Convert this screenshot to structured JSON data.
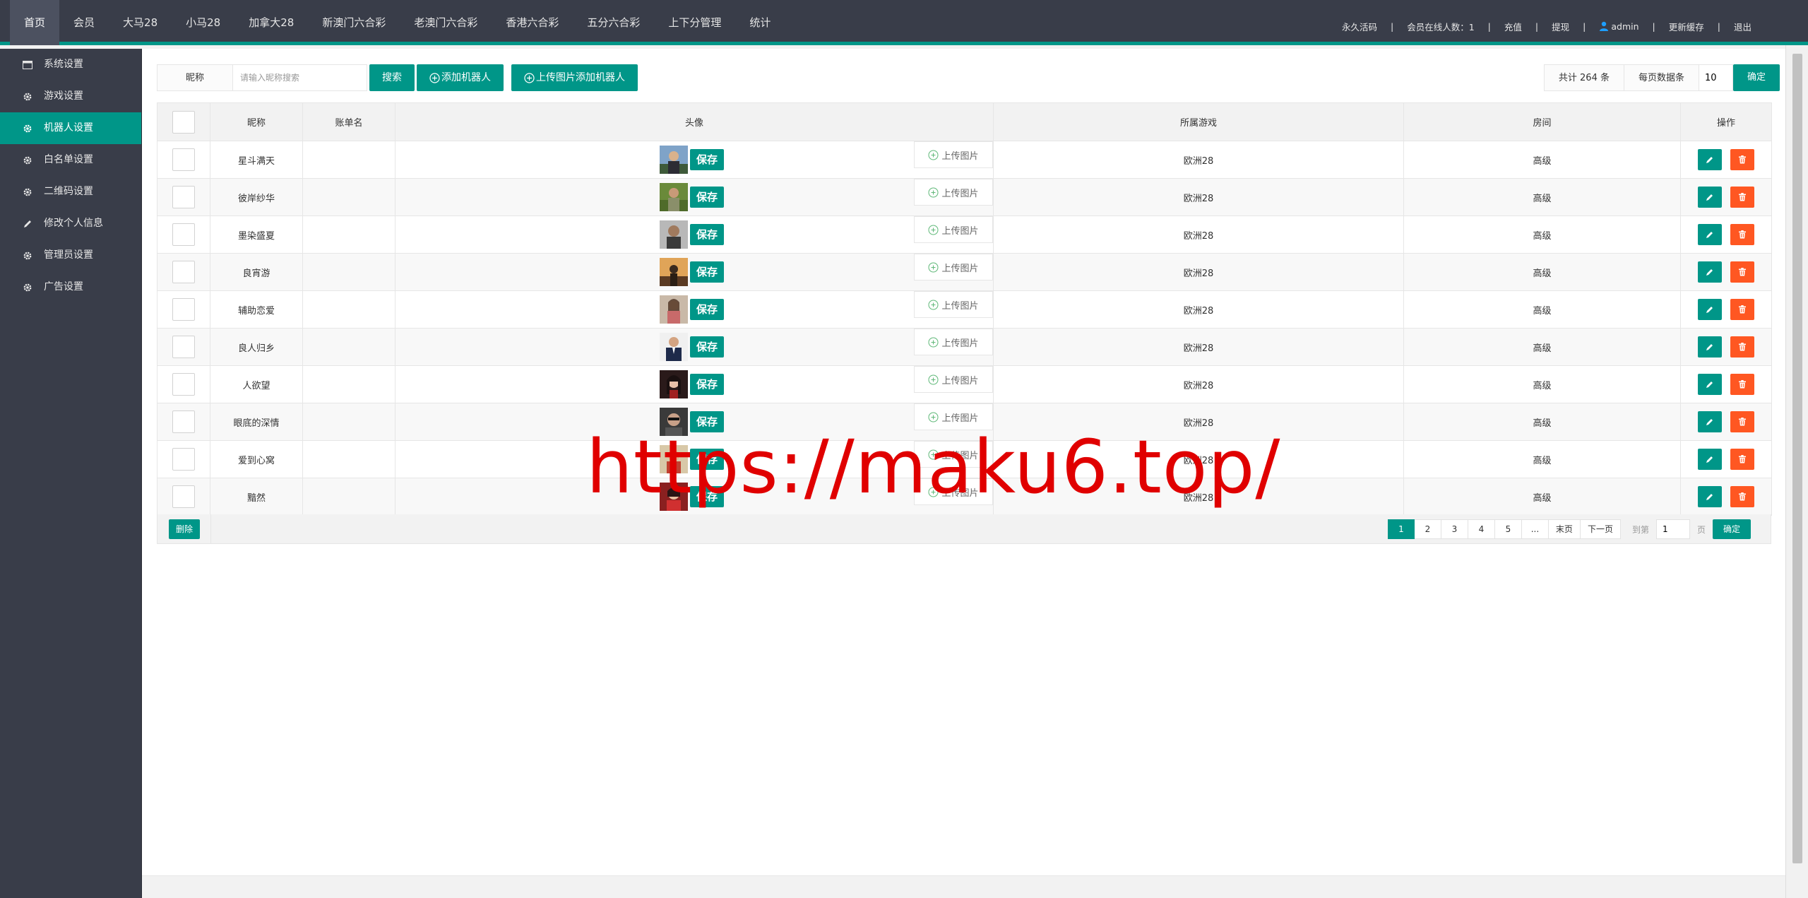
{
  "topnav": {
    "items": [
      {
        "label": "首页",
        "active": true
      },
      {
        "label": "会员"
      },
      {
        "label": "大马28"
      },
      {
        "label": "小马28"
      },
      {
        "label": "加拿大28"
      },
      {
        "label": "新澳门六合彩"
      },
      {
        "label": "老澳门六合彩"
      },
      {
        "label": "香港六合彩"
      },
      {
        "label": "五分六合彩"
      },
      {
        "label": "上下分管理"
      },
      {
        "label": "统计"
      }
    ]
  },
  "topright": {
    "permanent_code": "永久活码",
    "online_members": "会员在线人数：1",
    "recharge": "充值",
    "withdraw": "提现",
    "username": "admin",
    "refresh_cache": "更新缓存",
    "logout": "退出"
  },
  "sidebar": {
    "items": [
      {
        "label": "系统设置",
        "icon": "window-icon"
      },
      {
        "label": "游戏设置",
        "icon": "gear-icon"
      },
      {
        "label": "机器人设置",
        "icon": "gear-icon",
        "active": true
      },
      {
        "label": "白名单设置",
        "icon": "gear-icon"
      },
      {
        "label": "二维码设置",
        "icon": "gear-icon"
      },
      {
        "label": "修改个人信息",
        "icon": "pencil-icon"
      },
      {
        "label": "管理员设置",
        "icon": "gear-icon"
      },
      {
        "label": "广告设置",
        "icon": "gear-icon"
      }
    ]
  },
  "toolbar": {
    "nickname_label": "昵称",
    "search_placeholder": "请输入昵称搜索",
    "search_button": "搜索",
    "add_robot_button": "添加机器人",
    "upload_add_button": "上传图片添加机器人",
    "total": "共计 264 条",
    "per_page_label": "每页数据条",
    "per_page_value": "10",
    "confirm_button": "确定"
  },
  "table": {
    "headers": [
      "昵称",
      "账单名",
      "头像",
      "所属游戏",
      "房间",
      "操作"
    ],
    "save_label": "保存",
    "upload_label": "上传图片",
    "rows": [
      {
        "nickname": "星斗满天",
        "bill_name": "",
        "game": "欧洲28",
        "room": "高级"
      },
      {
        "nickname": "彼岸纱华",
        "bill_name": "",
        "game": "欧洲28",
        "room": "高级"
      },
      {
        "nickname": "墨染盛夏",
        "bill_name": "",
        "game": "欧洲28",
        "room": "高级"
      },
      {
        "nickname": "良宵游",
        "bill_name": "",
        "game": "欧洲28",
        "room": "高级"
      },
      {
        "nickname": "辅助恋爱",
        "bill_name": "",
        "game": "欧洲28",
        "room": "高级"
      },
      {
        "nickname": "良人归乡",
        "bill_name": "",
        "game": "欧洲28",
        "room": "高级"
      },
      {
        "nickname": "人欲望",
        "bill_name": "",
        "game": "欧洲28",
        "room": "高级"
      },
      {
        "nickname": "眼底的深情",
        "bill_name": "",
        "game": "欧洲28",
        "room": "高级"
      },
      {
        "nickname": "爱到心窝",
        "bill_name": "",
        "game": "欧洲28",
        "room": "高级"
      },
      {
        "nickname": "黯然",
        "bill_name": "",
        "game": "欧洲28",
        "room": "高级"
      }
    ]
  },
  "footer": {
    "delete_button": "删除",
    "pages": [
      "1",
      "2",
      "3",
      "4",
      "5",
      "...",
      "末页",
      "下一页"
    ],
    "current_page": "1",
    "goto_label": "到第",
    "goto_value": "1",
    "page_suffix": "页",
    "goto_button": "确定"
  },
  "watermark": "https://maku6.top/",
  "colors": {
    "topbar_bg": "#393d49",
    "accent": "#009688",
    "delete": "#ff5722",
    "watermark": "#e00000"
  }
}
